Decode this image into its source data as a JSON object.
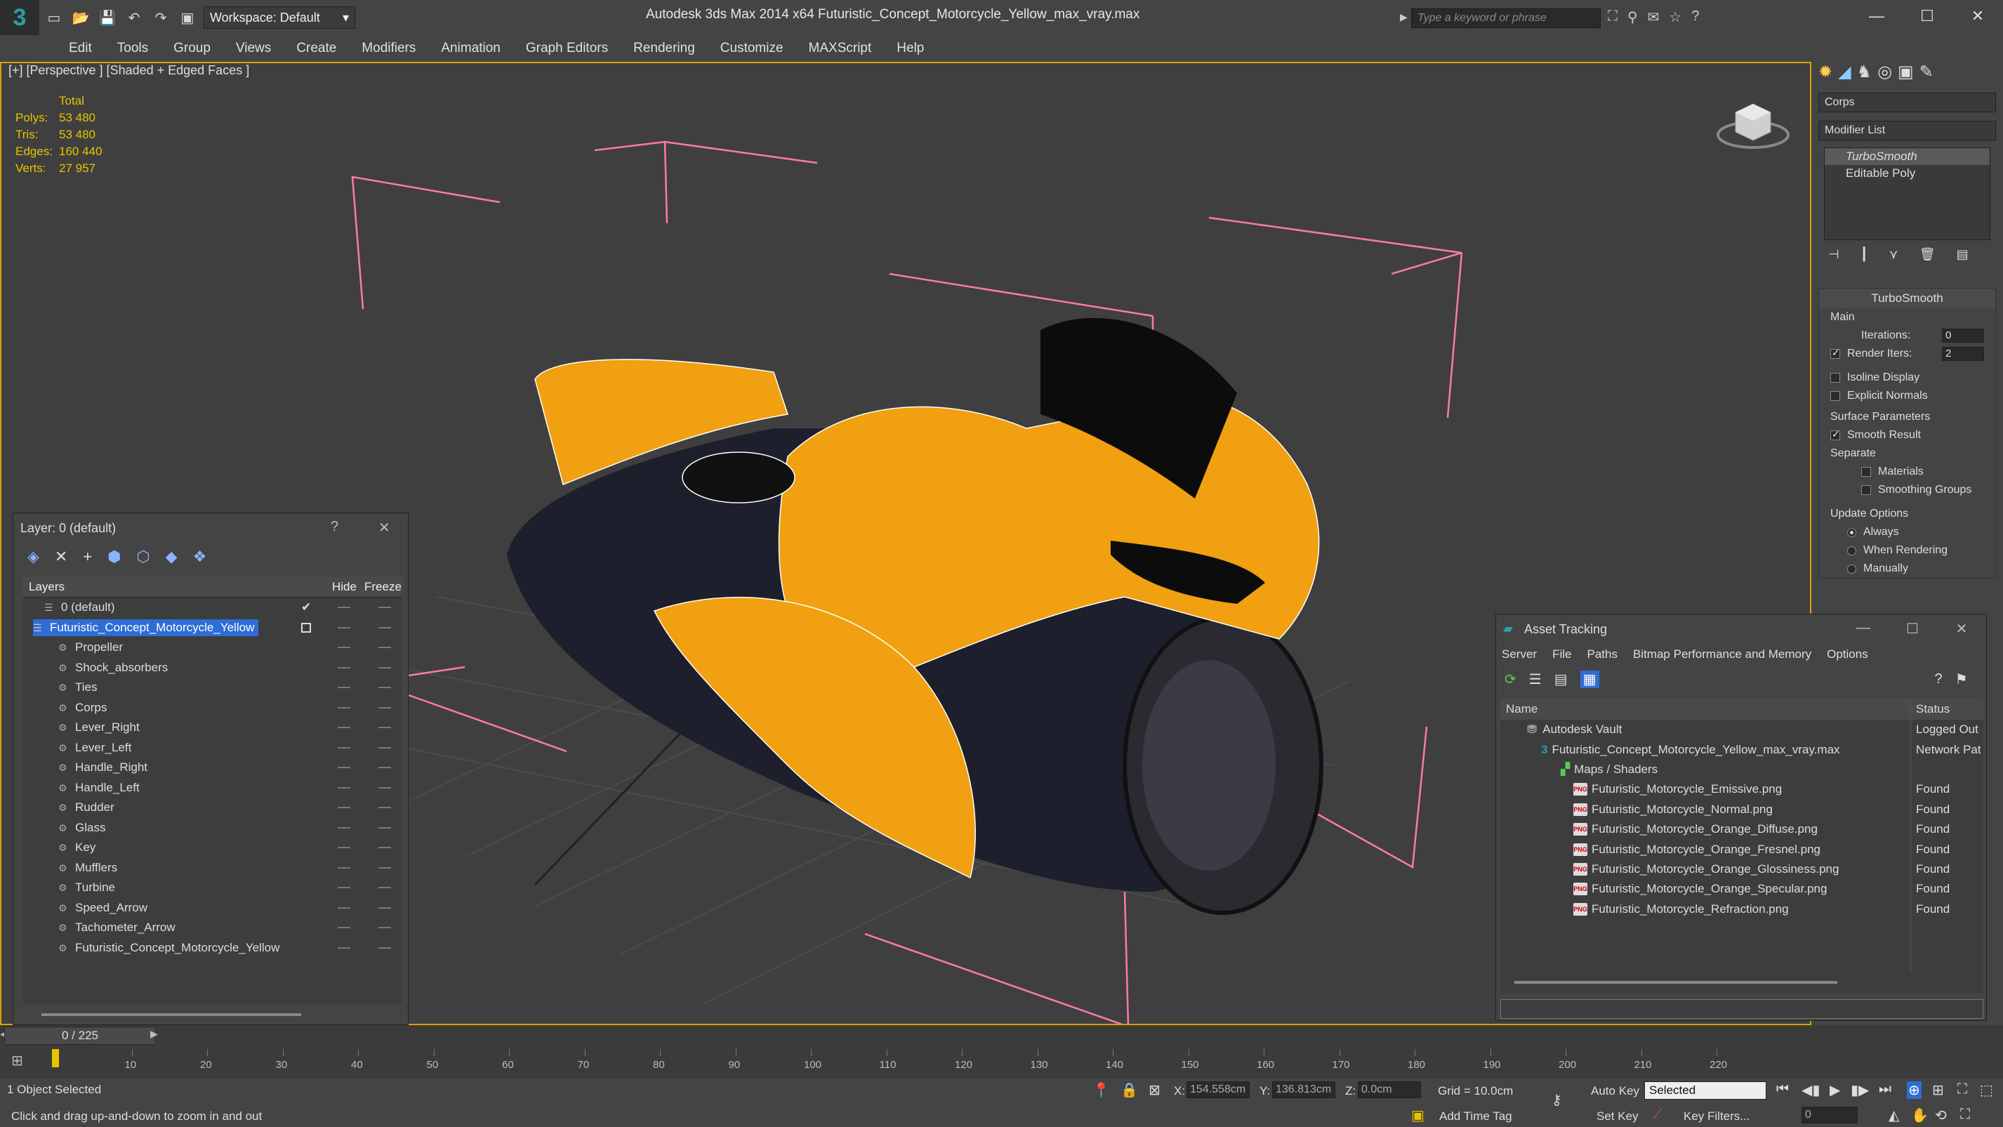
{
  "app": {
    "title": "Autodesk 3ds Max  2014 x64     Futuristic_Concept_Motorcycle_Yellow_max_vray.max",
    "logo": "3",
    "workspace": "Workspace: Default",
    "search_placeholder": "Type a keyword or phrase"
  },
  "menu": [
    "Edit",
    "Tools",
    "Group",
    "Views",
    "Create",
    "Modifiers",
    "Animation",
    "Graph Editors",
    "Rendering",
    "Customize",
    "MAXScript",
    "Help"
  ],
  "viewport": {
    "label": "[+] [Perspective ] [Shaded + Edged Faces ]",
    "stats_header": "Total",
    "stats": [
      {
        "k": "Polys:",
        "v": "53 480"
      },
      {
        "k": "Tris:",
        "v": "53 480"
      },
      {
        "k": "Edges:",
        "v": "160 440"
      },
      {
        "k": "Verts:",
        "v": "27 957"
      }
    ]
  },
  "layer_window": {
    "title": "Layer: 0 (default)",
    "help": "?",
    "close": "✕",
    "col_layers": "Layers",
    "col_hide": "Hide",
    "col_freeze": "Freeze",
    "rows": [
      {
        "name": "0 (default)",
        "level": 1,
        "selected": false
      },
      {
        "name": "Futuristic_Concept_Motorcycle_Yellow",
        "level": 1,
        "selected": true
      },
      {
        "name": "Propeller",
        "level": 2
      },
      {
        "name": "Shock_absorbers",
        "level": 2
      },
      {
        "name": "Ties",
        "level": 2
      },
      {
        "name": "Corps",
        "level": 2
      },
      {
        "name": "Lever_Right",
        "level": 2
      },
      {
        "name": "Lever_Left",
        "level": 2
      },
      {
        "name": "Handle_Right",
        "level": 2
      },
      {
        "name": "Handle_Left",
        "level": 2
      },
      {
        "name": "Rudder",
        "level": 2
      },
      {
        "name": "Glass",
        "level": 2
      },
      {
        "name": "Key",
        "level": 2
      },
      {
        "name": "Mufflers",
        "level": 2
      },
      {
        "name": "Turbine",
        "level": 2
      },
      {
        "name": "Speed_Arrow",
        "level": 2
      },
      {
        "name": "Tachometer_Arrow",
        "level": 2
      },
      {
        "name": "Futuristic_Concept_Motorcycle_Yellow",
        "level": 2
      }
    ]
  },
  "command_panel": {
    "object_name": "Corps",
    "modifier_list": "Modifier List",
    "modifiers": [
      "TurboSmooth",
      "Editable Poly"
    ],
    "rollout": "TurboSmooth",
    "main": "Main",
    "iterations_label": "Iterations:",
    "iterations": "0",
    "render_iters_label": "Render Iters:",
    "render_iters": "2",
    "isoline": "Isoline Display",
    "explicit": "Explicit Normals",
    "surface": "Surface Parameters",
    "smooth_result": "Smooth Result",
    "separate": "Separate",
    "materials": "Materials",
    "smoothing_groups": "Smoothing Groups",
    "update_options": "Update Options",
    "always": "Always",
    "when_rendering": "When Rendering",
    "manually": "Manually"
  },
  "asset_tracking": {
    "title": "Asset Tracking",
    "menu": [
      "Server",
      "File",
      "Paths",
      "Bitmap Performance and Memory",
      "Options"
    ],
    "col_name": "Name",
    "col_status": "Status",
    "rows": [
      {
        "name": "Autodesk Vault",
        "status": "Logged Out",
        "level": 1,
        "icon": "vault"
      },
      {
        "name": "Futuristic_Concept_Motorcycle_Yellow_max_vray.max",
        "status": "Network Pat",
        "level": 2,
        "icon": "max"
      },
      {
        "name": "Maps / Shaders",
        "status": "",
        "level": 3,
        "icon": "maps"
      },
      {
        "name": "Futuristic_Motorcycle_Emissive.png",
        "status": "Found",
        "level": 4,
        "icon": "png"
      },
      {
        "name": "Futuristic_Motorcycle_Normal.png",
        "status": "Found",
        "level": 4,
        "icon": "png"
      },
      {
        "name": "Futuristic_Motorcycle_Orange_Diffuse.png",
        "status": "Found",
        "level": 4,
        "icon": "png"
      },
      {
        "name": "Futuristic_Motorcycle_Orange_Fresnel.png",
        "status": "Found",
        "level": 4,
        "icon": "png"
      },
      {
        "name": "Futuristic_Motorcycle_Orange_Glossiness.png",
        "status": "Found",
        "level": 4,
        "icon": "png"
      },
      {
        "name": "Futuristic_Motorcycle_Orange_Specular.png",
        "status": "Found",
        "level": 4,
        "icon": "png"
      },
      {
        "name": "Futuristic_Motorcycle_Refraction.png",
        "status": "Found",
        "level": 4,
        "icon": "png"
      }
    ]
  },
  "timeline": {
    "frame": "0 / 225",
    "ticks": [
      "10",
      "20",
      "30",
      "40",
      "50",
      "60",
      "70",
      "80",
      "90",
      "100",
      "110",
      "120",
      "130",
      "140",
      "150",
      "160",
      "170",
      "180",
      "190",
      "200",
      "210",
      "220"
    ]
  },
  "status": {
    "selected": "1 Object Selected",
    "hint": "Click and drag up-and-down to zoom in and out",
    "x_label": "X:",
    "x": "154.558cm",
    "y_label": "Y:",
    "y": "136.813cm",
    "z_label": "Z:",
    "z": "0.0cm",
    "grid": "Grid = 10.0cm",
    "auto_key": "Auto Key",
    "selected_dd": "Selected",
    "set_key": "Set Key",
    "key_filters": "Key Filters...",
    "add_time_tag": "Add Time Tag",
    "frame_field": "0"
  },
  "colors": {
    "accent": "#d9a400",
    "selection": "#2e6dd6",
    "stats": "#e8c400",
    "bike": "#f0a010"
  }
}
